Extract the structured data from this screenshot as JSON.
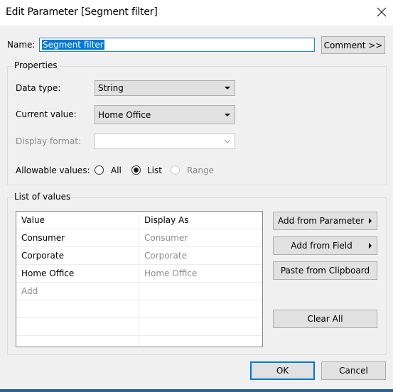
{
  "window": {
    "title": "Edit Parameter [Segment filter]",
    "close_icon": "close-x"
  },
  "name_row": {
    "label": "Name:",
    "value": "Segment filter",
    "comment_button": "Comment >>"
  },
  "properties": {
    "group_title": "Properties",
    "data_type": {
      "label": "Data type:",
      "value": "String"
    },
    "current_value": {
      "label": "Current value:",
      "value": "Home Office"
    },
    "display_format": {
      "label": "Display format:",
      "value": ""
    },
    "allowable_values": {
      "label": "Allowable values:",
      "options": [
        {
          "label": "All",
          "selected": false,
          "enabled": true
        },
        {
          "label": "List",
          "selected": true,
          "enabled": true
        },
        {
          "label": "Range",
          "selected": false,
          "enabled": false
        }
      ]
    }
  },
  "list_of_values": {
    "group_title": "List of values",
    "columns": [
      "Value",
      "Display As"
    ],
    "rows": [
      {
        "value": "Consumer",
        "display_as": "Consumer"
      },
      {
        "value": "Corporate",
        "display_as": "Corporate"
      },
      {
        "value": "Home Office",
        "display_as": "Home Office"
      }
    ],
    "add_placeholder": "Add",
    "buttons": {
      "add_from_parameter": "Add from Parameter",
      "add_from_field": "Add from Field",
      "paste_from_clipboard": "Paste from Clipboard",
      "clear_all": "Clear All"
    }
  },
  "footer": {
    "ok": "OK",
    "cancel": "Cancel"
  },
  "colors": {
    "accent": "#0078d7",
    "dialog_bg": "#f0f0f0",
    "button_bg": "#e1e1e1"
  }
}
